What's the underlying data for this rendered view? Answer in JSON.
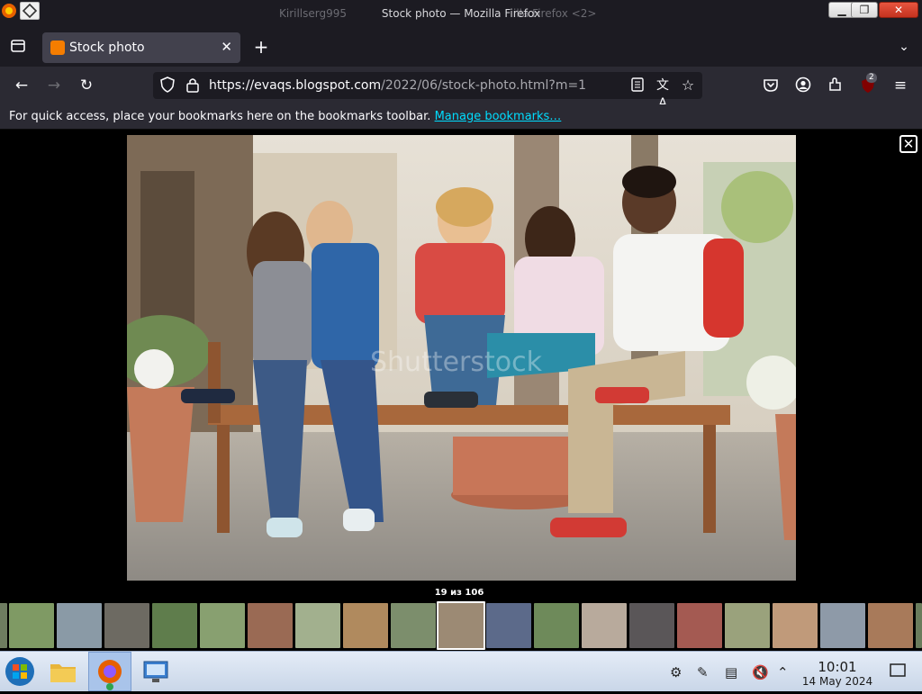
{
  "window": {
    "title": "Stock photo — Mozilla Firefox",
    "ghost_left": "Kirillserg995",
    "ghost_right": "illa Firefox <2>"
  },
  "tabs": [
    {
      "label": "Stock photo"
    }
  ],
  "navbar": {
    "url_host": "https://evaqs.blogspot.com",
    "url_path": "/2022/06/stock-photo.html?m=1",
    "extension_badge": "2"
  },
  "bookmarks_bar": {
    "message": "For quick access, place your bookmarks here on the bookmarks toolbar.",
    "link": "Manage bookmarks…"
  },
  "viewer": {
    "counter": "19 из 106",
    "watermark": "Shutterstock"
  },
  "taskbar": {
    "time": "10:01",
    "date": "14 May 2024"
  },
  "colors": {
    "firefox_dark": "#1c1b22",
    "toolbar": "#2b2a33",
    "link": "#00ddff"
  }
}
